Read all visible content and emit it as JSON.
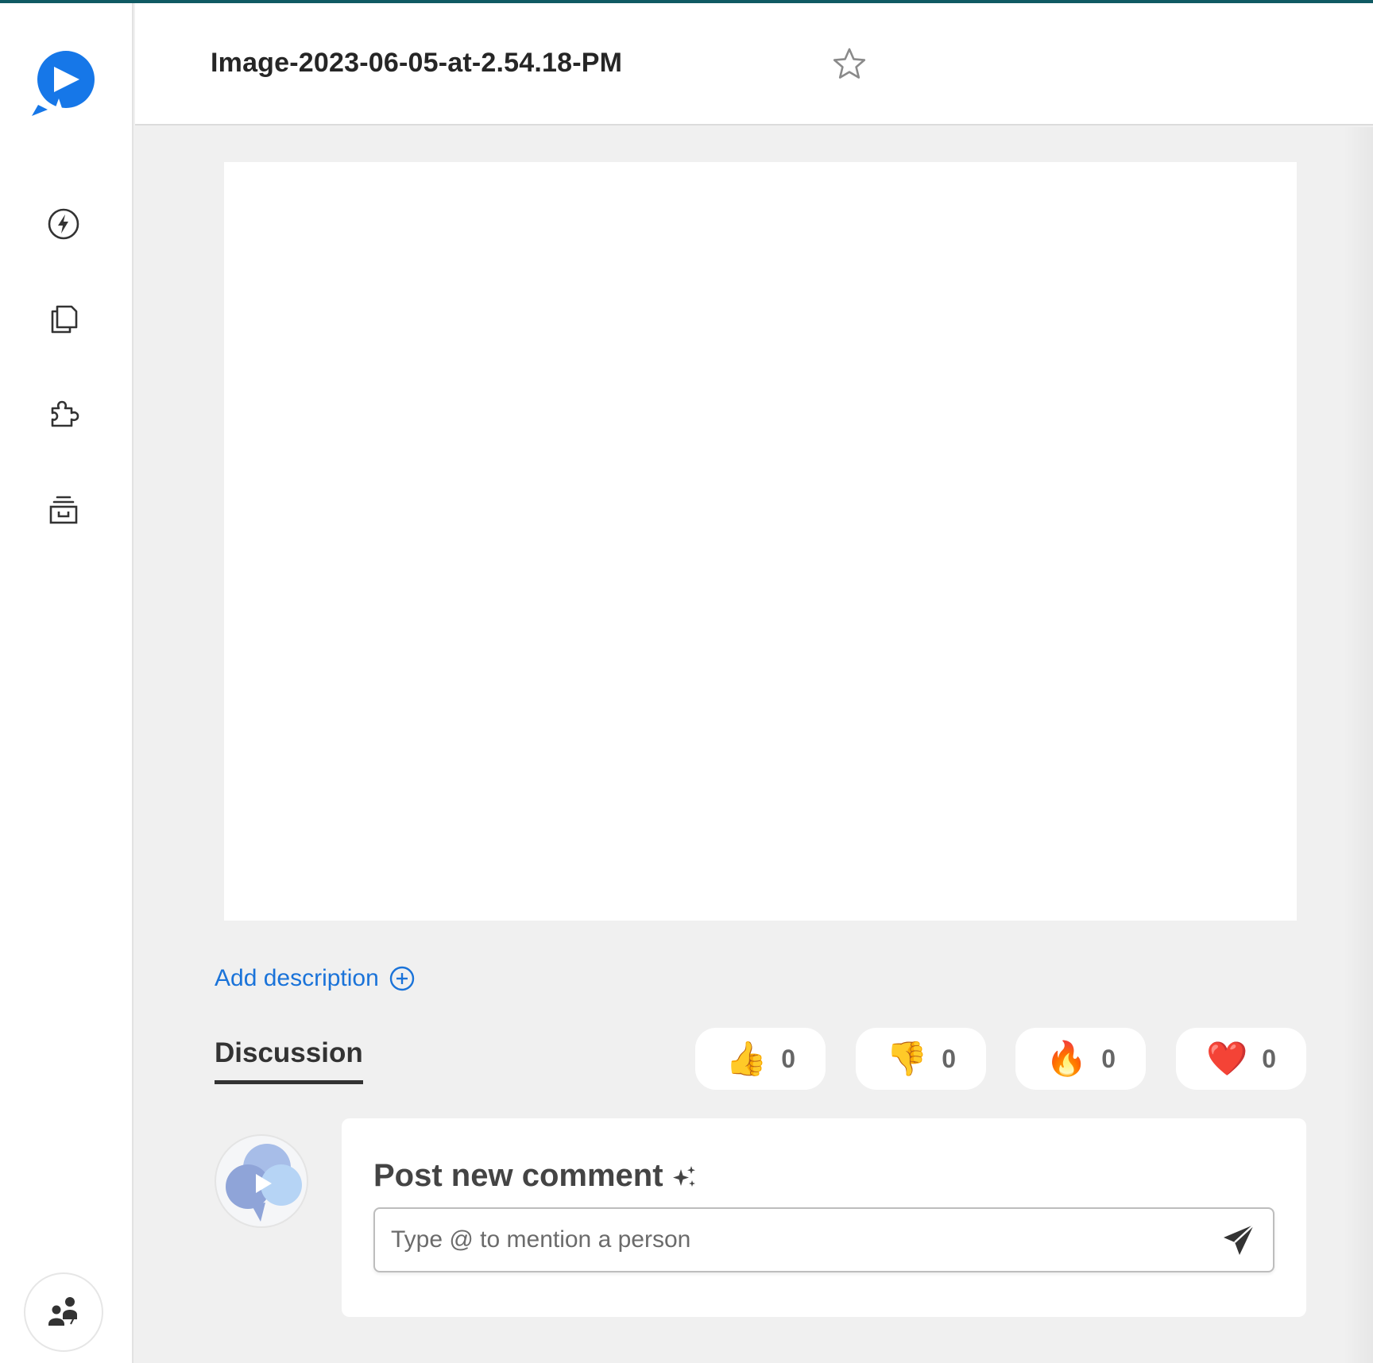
{
  "header": {
    "title": "Image-2023-06-05-at-2.54.18-PM",
    "star_icon": "star-outline-icon"
  },
  "sidebar": {
    "logo": "app-logo",
    "items": [
      {
        "name": "activity",
        "icon": "lightning-bolt-icon"
      },
      {
        "name": "pages",
        "icon": "copy-pages-icon"
      },
      {
        "name": "integrations",
        "icon": "puzzle-piece-icon"
      },
      {
        "name": "archive",
        "icon": "archive-box-icon"
      }
    ],
    "team_icon": "team-people-icon"
  },
  "preview": {
    "content": "blank-white-image"
  },
  "description": {
    "add_label": "Add description"
  },
  "discussion": {
    "tab_label": "Discussion"
  },
  "reactions": [
    {
      "emoji": "👍",
      "count": "0"
    },
    {
      "emoji": "👎",
      "count": "0"
    },
    {
      "emoji": "🔥",
      "count": "0"
    },
    {
      "emoji": "❤️",
      "count": "0"
    }
  ],
  "comment": {
    "heading": "Post new comment",
    "input_value": "",
    "placeholder": "Type @ to mention a person"
  },
  "colors": {
    "accent": "#1a73d9",
    "brand": "#1677e8",
    "top_line": "#0f5a63",
    "background": "#f0f0f0"
  }
}
